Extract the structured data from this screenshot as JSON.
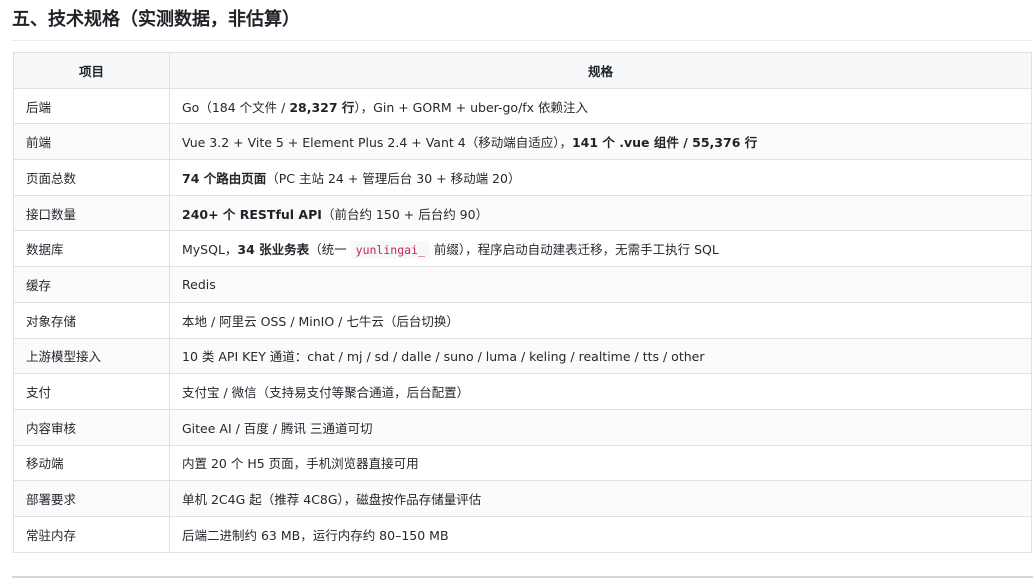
{
  "section": {
    "title": "五、技术规格（实测数据，非估算）"
  },
  "table": {
    "headers": [
      "项目",
      "规格"
    ],
    "rows": [
      {
        "item": "后端",
        "spec": [
          {
            "t": "Go（184 个文件 / "
          },
          {
            "t": "28,327 行",
            "b": true
          },
          {
            "t": "），Gin + GORM + uber-go/fx 依赖注入"
          }
        ]
      },
      {
        "item": "前端",
        "spec": [
          {
            "t": "Vue 3.2 + Vite 5 + Element Plus 2.4 + Vant 4（移动端自适应），"
          },
          {
            "t": "141 个 .vue 组件 / 55,376 行",
            "b": true
          }
        ]
      },
      {
        "item": "页面总数",
        "spec": [
          {
            "t": "74 个路由页面",
            "b": true
          },
          {
            "t": "（PC 主站 24 + 管理后台 30 + 移动端 20）"
          }
        ]
      },
      {
        "item": "接口数量",
        "spec": [
          {
            "t": "240+ 个 RESTful API",
            "b": true
          },
          {
            "t": "（前台约 150 + 后台约 90）"
          }
        ]
      },
      {
        "item": "数据库",
        "spec": [
          {
            "t": "MySQL，"
          },
          {
            "t": "34 张业务表",
            "b": true
          },
          {
            "t": "（统一 "
          },
          {
            "t": "yunlingai_",
            "code": true
          },
          {
            "t": " 前缀），程序启动自动建表迁移，无需手工执行 SQL"
          }
        ]
      },
      {
        "item": "缓存",
        "spec": [
          {
            "t": "Redis"
          }
        ]
      },
      {
        "item": "对象存储",
        "spec": [
          {
            "t": "本地 / 阿里云 OSS / MinIO / 七牛云（后台切换）"
          }
        ]
      },
      {
        "item": "上游模型接入",
        "spec": [
          {
            "t": "10 类 API KEY 通道：chat / mj / sd / dalle / suno / luma / keling / realtime / tts / other"
          }
        ]
      },
      {
        "item": "支付",
        "spec": [
          {
            "t": "支付宝 / 微信（支持易支付等聚合通道，后台配置）"
          }
        ]
      },
      {
        "item": "内容审核",
        "spec": [
          {
            "t": "Gitee AI / 百度 / 腾讯 三通道可切"
          }
        ]
      },
      {
        "item": "移动端",
        "spec": [
          {
            "t": "内置 20 个 H5 页面，手机浏览器直接可用"
          }
        ]
      },
      {
        "item": "部署要求",
        "spec": [
          {
            "t": "单机 2C4G 起（推荐 4C8G），磁盘按作品存储量评估"
          }
        ]
      },
      {
        "item": "常驻内存",
        "spec": [
          {
            "t": "后端二进制约 63 MB，运行内存约 80–150 MB"
          }
        ]
      }
    ]
  }
}
